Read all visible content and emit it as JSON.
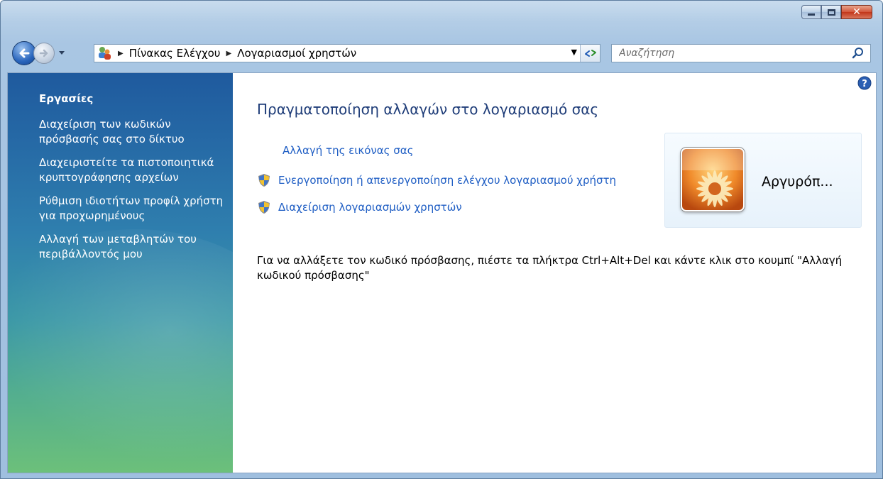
{
  "breadcrumb": {
    "items": [
      "Πίνακας Ελέγχου",
      "Λογαριασμοί χρηστών"
    ]
  },
  "search": {
    "placeholder": "Αναζήτηση"
  },
  "sidebar": {
    "title": "Εργασίες",
    "items": [
      "Διαχείριση των κωδικών πρόσβασής σας στο δίκτυο",
      "Διαχειριστείτε τα πιστοποιητικά κρυπτογράφησης αρχείων",
      "Ρύθμιση ιδιοτήτων προφίλ χρήστη για προχωρημένους",
      "Αλλαγή των μεταβλητών του περιβάλλοντός μου"
    ]
  },
  "main": {
    "title": "Πραγματοποίηση αλλαγών στο λογαριασμό σας",
    "tasks": [
      "Αλλαγή της εικόνας σας",
      "Ενεργοποίηση ή απενεργοποίηση ελέγχου λογαριασμού χρήστη",
      "Διαχείριση λογαριασμών χρηστών"
    ],
    "note": "Για να αλλάξετε τον κωδικό πρόσβασης, πιέστε τα πλήκτρα Ctrl+Alt+Del και κάντε κλικ στο κουμπί \"Αλλαγή κωδικού πρόσβασης\""
  },
  "user": {
    "name": "Αργυρόπ..."
  },
  "icons": {
    "back": "back-arrow-icon",
    "forward": "forward-arrow-icon",
    "control_panel": "control-panel-users-icon",
    "refresh": "refresh-icon",
    "search": "search-icon",
    "help": "help-icon",
    "shield": "uac-shield-icon"
  },
  "colors": {
    "link": "#1f5ec4",
    "title": "#1e3c78",
    "sidebar_top": "#1f5a9e",
    "sidebar_bottom": "#6cc07a"
  }
}
